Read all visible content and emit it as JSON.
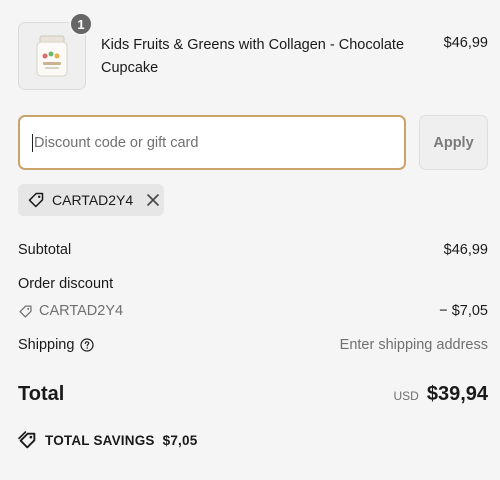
{
  "cart": {
    "items": [
      {
        "quantity": "1",
        "name": "Kids Fruits & Greens with Collagen - Chocolate Cupcake",
        "price": "$46,99",
        "image_icon": "product-jar-icon"
      }
    ]
  },
  "discount": {
    "placeholder": "Discount code or gift card",
    "value": "",
    "apply_label": "Apply",
    "applied_code": "CARTAD2Y4"
  },
  "summary": {
    "subtotal_label": "Subtotal",
    "subtotal_value": "$46,99",
    "order_discount_label": "Order discount",
    "discount_code": "CARTAD2Y4",
    "discount_value": "− $7,05",
    "shipping_label": "Shipping",
    "shipping_value": "Enter shipping address",
    "total_label": "Total",
    "currency": "USD",
    "total_value": "$39,94",
    "savings_label": "TOTAL SAVINGS",
    "savings_value": "$7,05"
  },
  "colors": {
    "background": "#f5f5f5",
    "input_focus_border": "#c9a36a",
    "muted_text": "#707070",
    "badge": "#666666"
  }
}
